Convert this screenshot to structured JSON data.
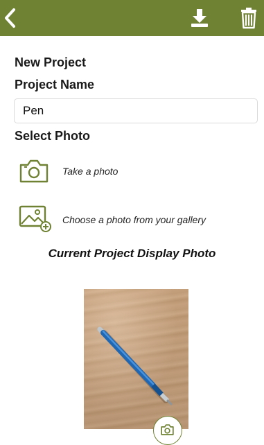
{
  "header": {
    "background_color": "#6f8233",
    "icons": [
      "back-arrow-icon",
      "download-icon",
      "trash-icon"
    ]
  },
  "form": {
    "new_project_heading": "New Project",
    "project_name_label": "Project Name",
    "project_name_value": "Pen",
    "select_photo_label": "Select Photo"
  },
  "photo_options": {
    "take_photo_label": "Take a photo",
    "gallery_label": "Choose a photo from your gallery"
  },
  "display": {
    "title": "Current Project Display Photo"
  },
  "colors": {
    "accent": "#6f8233",
    "text": "#111111"
  }
}
